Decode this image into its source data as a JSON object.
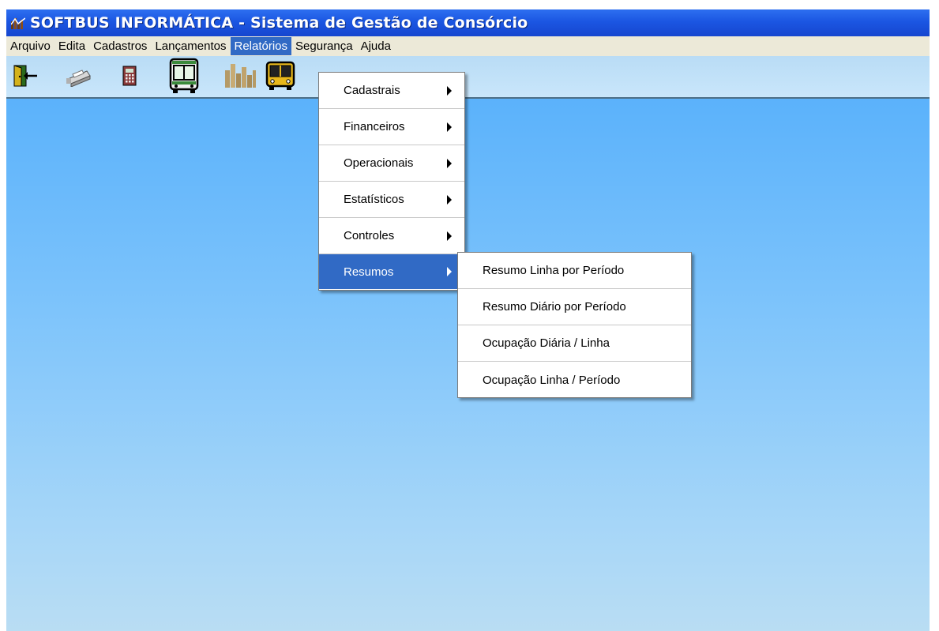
{
  "window": {
    "title": "SOFTBUS INFORMÁTICA - Sistema de Gestão de Consórcio",
    "title_icon": "chart-bars-icon"
  },
  "menubar": {
    "items": [
      "Arquivo",
      "Edita",
      "Cadastros",
      "Lançamentos",
      "Relatórios",
      "Segurança",
      "Ajuda"
    ],
    "active": "Relatórios"
  },
  "toolbar": {
    "buttons": [
      {
        "icon": "exit-door-icon"
      },
      {
        "icon": "printer-icon"
      },
      {
        "icon": "calculator-icon"
      },
      {
        "icon": "bus-front-white-icon"
      },
      {
        "icon": "bar-chart-icon"
      },
      {
        "icon": "bus-front-yellow-icon"
      }
    ]
  },
  "relatorios_menu": {
    "items": [
      "Cadastrais",
      "Financeiros",
      "Operacionais",
      "Estatísticos",
      "Controles",
      "Resumos"
    ],
    "active": "Resumos"
  },
  "resumos_submenu": {
    "items": [
      "Resumo Linha por Período",
      "Resumo Diário por Período",
      "Ocupação Diária / Linha",
      "Ocupação Linha / Período"
    ]
  },
  "colors": {
    "titlebar": "#1b56e2",
    "menubar": "#ece9d8",
    "highlight": "#316ac5",
    "client_top": "#5bb2fb",
    "client_bottom": "#b9ddf3"
  }
}
